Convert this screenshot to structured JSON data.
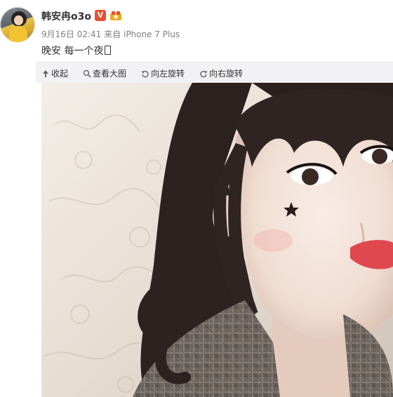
{
  "post": {
    "username": "韩安冉o3o",
    "vip_badge": "V",
    "timestamp": "9月16日 02:41",
    "source_prefix": "来自",
    "device": "iPhone 7 Plus",
    "text": "晚安 每一个夜"
  },
  "toolbar": {
    "collapse_label": "收起",
    "view_large_label": "查看大图",
    "rotate_left_label": "向左旋转",
    "rotate_right_label": "向右旋转"
  },
  "icons": {
    "collapse": "arrow-up-icon",
    "view_large": "magnifier-icon",
    "rotate_left": "rotate-left-icon",
    "rotate_right": "rotate-right-icon",
    "medal": "medal-icon"
  },
  "colors": {
    "vip_badge": "#e8502f",
    "toolbar_bg": "#f2f2f5",
    "meta_text": "#808080"
  }
}
